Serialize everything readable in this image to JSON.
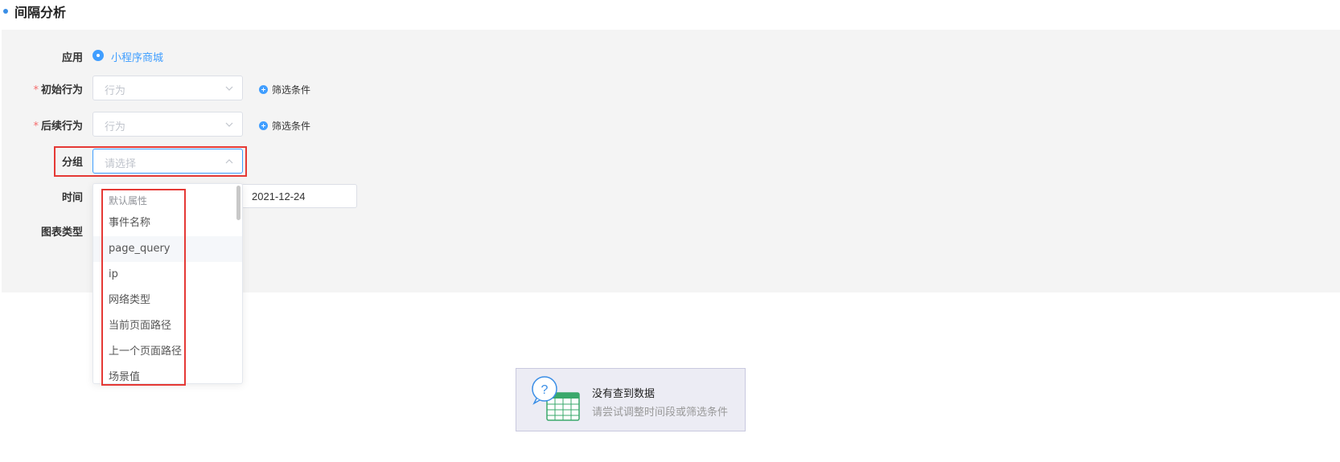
{
  "page": {
    "title": "间隔分析"
  },
  "form": {
    "app": {
      "label": "应用",
      "selected": "小程序商城"
    },
    "initial_behavior": {
      "required_mark": "*",
      "label": "初始行为",
      "placeholder": "行为",
      "filter_label": "筛选条件"
    },
    "subsequent_behavior": {
      "required_mark": "*",
      "label": "后续行为",
      "placeholder": "行为",
      "filter_label": "筛选条件"
    },
    "group": {
      "label": "分组",
      "placeholder": "请选择",
      "options_group_label": "默认属性",
      "options": [
        "事件名称",
        "page_query",
        "ip",
        "网络类型",
        "当前页面路径",
        "上一个页面路径",
        "场景值"
      ],
      "hovered_option": "page_query"
    },
    "time": {
      "label": "时间",
      "end_date": "2021-12-24"
    },
    "chart_type": {
      "label": "图表类型"
    }
  },
  "empty_state": {
    "title": "没有查到数据",
    "subtitle": "请尝试调整时间段或筛选条件",
    "icon": "question-table-icon"
  },
  "colors": {
    "accent": "#409eff",
    "highlight": "#e53935",
    "panel_bg": "#f4f4f4"
  }
}
